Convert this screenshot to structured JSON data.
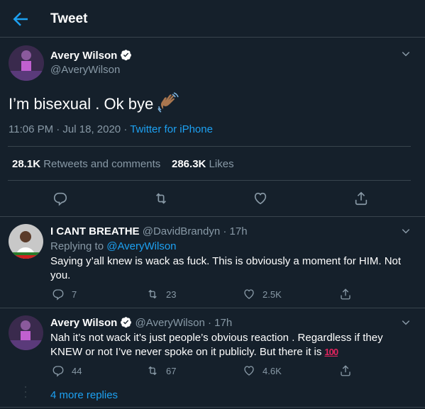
{
  "header": {
    "title": "Tweet"
  },
  "main_tweet": {
    "name": "Avery Wilson",
    "handle": "@AveryWilson",
    "text": "I’m bisexual . Ok bye",
    "time": "11:06 PM · Jul 18, 2020",
    "dot": " · ",
    "source": "Twitter for iPhone",
    "retweets_count": "28.1K",
    "retweets_label": "Retweets and comments",
    "likes_count": "286.3K",
    "likes_label": "Likes"
  },
  "replies": [
    {
      "name": "I CANT BREATHE",
      "handle": "@DavidBrandyn",
      "time": "· 17h",
      "replying_to_label": "Replying to",
      "replying_to_handle": "@AveryWilson",
      "text": "Saying y’all knew is wack as fuck. This is obviously a moment for HIM. Not you.",
      "replies": "7",
      "retweets": "23",
      "likes": "2.5K"
    },
    {
      "name": "Avery Wilson",
      "handle": "@AveryWilson",
      "time": "· 17h",
      "text": "Nah it’s not wack it’s just people’s obvious reaction . Regardless if they KNEW or not I’ve never spoke on it publicly. But there it is",
      "emoji": "100",
      "replies": "44",
      "retweets": "67",
      "likes": "4.6K"
    }
  ],
  "more_replies": "4 more replies",
  "colors": {
    "background": "#15202b",
    "accent": "#1da1f2",
    "border": "#38444d",
    "muted": "#8899a6"
  }
}
